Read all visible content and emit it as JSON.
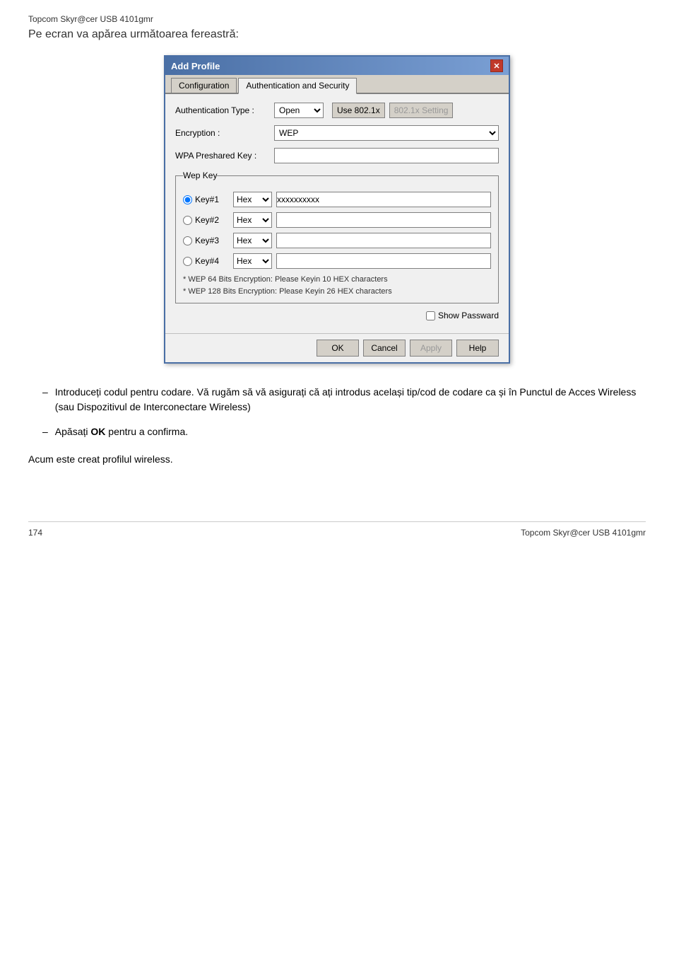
{
  "header": {
    "small": "Topcom Skyr@cer USB 4101gmr",
    "large": "Pe ecran va apărea următoarea fereastră:"
  },
  "dialog": {
    "title": "Add Profile",
    "close_btn": "✕",
    "tabs": [
      {
        "label": "Configuration",
        "active": false
      },
      {
        "label": "Authentication and Security",
        "active": true
      }
    ],
    "auth_type_label": "Authentication Type :",
    "auth_type_value": "Open",
    "use802_label": "Use 802.1x",
    "setting802_label": "802.1x Setting",
    "encryption_label": "Encryption :",
    "encryption_value": "WEP",
    "wpa_label": "WPA Preshared Key :",
    "wep_group_label": "Wep Key",
    "keys": [
      {
        "id": "Key#1",
        "selected": true,
        "type": "Hex",
        "value": "xxxxxxxxxx"
      },
      {
        "id": "Key#2",
        "selected": false,
        "type": "Hex",
        "value": ""
      },
      {
        "id": "Key#3",
        "selected": false,
        "type": "Hex",
        "value": ""
      },
      {
        "id": "Key#4",
        "selected": false,
        "type": "Hex",
        "value": ""
      }
    ],
    "hint1": "* WEP 64 Bits Encryption:   Please Keyin 10 HEX characters",
    "hint2": "* WEP 128 Bits Encryption:  Please Keyin 26 HEX characters",
    "show_password_label": "Show Passward",
    "buttons": {
      "ok": "OK",
      "cancel": "Cancel",
      "apply": "Apply",
      "help": "Help"
    }
  },
  "bullets": [
    {
      "text": "Introduceți codul pentru codare. Vă rugăm să vă asigurați că ați introdus același tip/cod de codare ca și în Punctul de Acces Wireless (sau Dispozitivul de Interconectare Wireless)"
    },
    {
      "text": "Apăsați OK pentru a confirma.",
      "bold_word": "OK"
    }
  ],
  "footer_note": "Acum este creat profilul wireless.",
  "page_number": "174",
  "footer_right": "Topcom Skyr@cer USB 4101gmr"
}
